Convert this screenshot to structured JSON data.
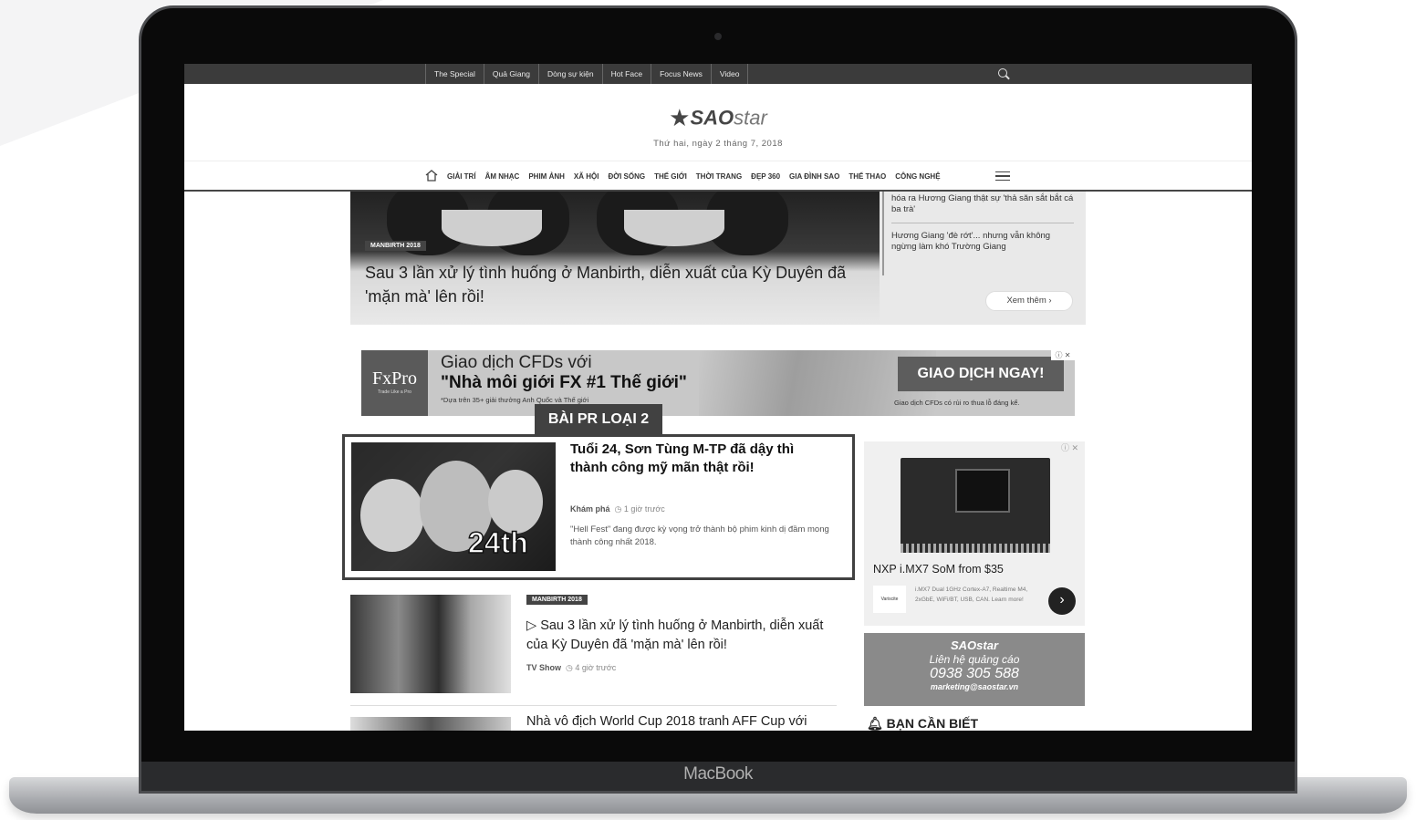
{
  "device": {
    "brand_label": "MacBook"
  },
  "topnav": {
    "items": [
      "The Special",
      "Quả Giang",
      "Dòng sự kiện",
      "Hot Face",
      "Focus News",
      "Video"
    ]
  },
  "site": {
    "logo_sao": "SAO",
    "logo_star": "star",
    "date": "Thứ hai, ngày 2 tháng 7, 2018"
  },
  "mainnav": {
    "items": [
      "GIẢI TRÍ",
      "ÂM NHẠC",
      "PHIM ẢNH",
      "XÃ HỘI",
      "ĐỜI SỐNG",
      "THẾ GIỚI",
      "THỜI TRANG",
      "ĐẸP 360",
      "GIA ĐÌNH SAO",
      "THỂ THAO",
      "CÔNG NGHỆ"
    ]
  },
  "hero": {
    "tag": "MANBIRTH 2018",
    "title": "Sau 3 lần xử lý tình huống ở Manbirth, diễn xuất của Kỳ Duyên đã 'mặn mà' lên rồi!",
    "side_1": "hóa ra Hương Giang thật sự 'thả săn sắt bắt cá ba trà'",
    "side_2": "Hương Giang 'đè rớt'... nhưng vẫn không ngừng làm khó Trường Giang",
    "more": "Xem thêm ›"
  },
  "ad": {
    "brand": "FxPro",
    "brand_sub": "Trade Like a Pro",
    "line1": "Giao dịch CFDs với",
    "line2": "\"Nhà môi giới FX #1 Thế giới\"",
    "line3": "*Dựa trên 35+ giải thưởng Anh Quốc và Thế giới",
    "cta": "GIAO DỊCH NGAY!",
    "cta_note": "Giao dịch CFDs có rủi ro thua lỗ đáng kể.",
    "close": "ⓘ ✕"
  },
  "pr": {
    "label": "BÀI PR LOẠI 2",
    "title": "Tuổi 24, Sơn Tùng M-TP đã dậy thì thành công mỹ mãn thật rồi!",
    "category": "Khám phá",
    "time": "1 giờ trước",
    "desc": "\"Hell Fest\" đang được kỳ vọng trở thành bộ phim kinh dị đầm mong thành công nhất 2018.",
    "image_text": "24th"
  },
  "article2": {
    "tag": "MANBIRTH 2018",
    "title": "Sau 3 lần xử lý tình huống ở Manbirth, diễn xuất của Kỳ Duyên đã 'mặn mà' lên rồi!",
    "category": "TV Show",
    "time": "4 giờ trước"
  },
  "article3": {
    "title": "Nhà vô địch World Cup 2018 tranh AFF Cup với"
  },
  "right_ad": {
    "close": "ⓘ ✕",
    "title": "NXP i.MX7 SoM from $35",
    "logo": "Variscite",
    "desc": "i.MX7 Dual 1GHz Cortex-A7, Realtime M4, 2xGbE, WiFi/BT, USB, CAN. Learn more!"
  },
  "contact": {
    "logo": "SAOstar",
    "label": "Liên hệ quảng cáo",
    "phone": "0938 305 588",
    "email": "marketing@saostar.vn"
  },
  "sidebar": {
    "heading": "BẠN CẦN BIẾT"
  }
}
